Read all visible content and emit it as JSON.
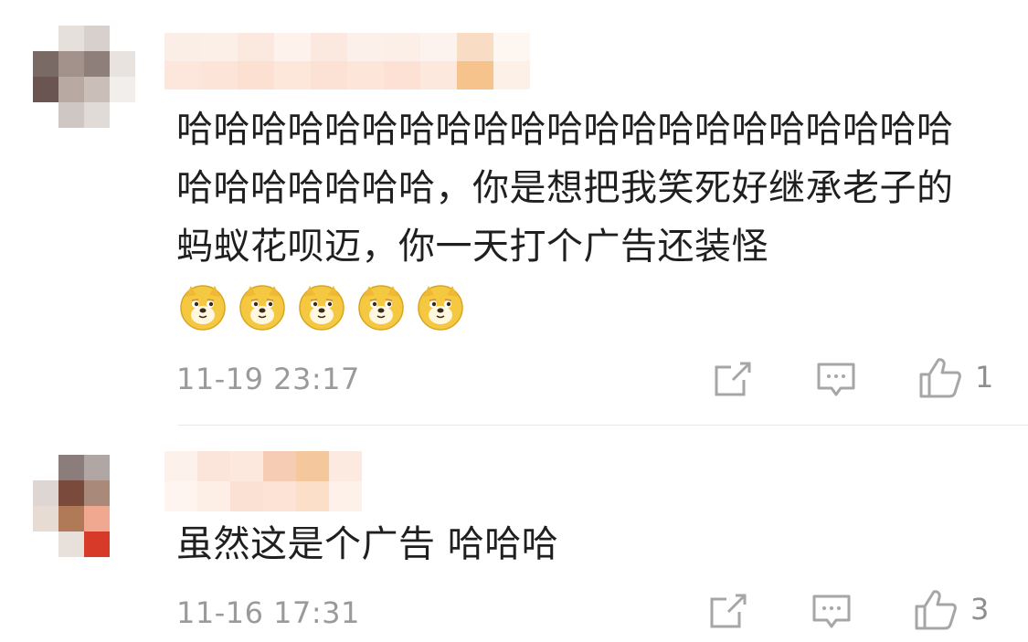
{
  "comments": [
    {
      "text": "哈哈哈哈哈哈哈哈哈哈哈哈哈哈哈哈哈哈哈哈哈哈哈哈哈哈哈哈，你是想把我笑死好继承老子的蚂蚁花呗迈，你一天打个广告还装怪",
      "emoji_name": "doge-emoji",
      "emoji_count": 5,
      "timestamp": "11-19 23:17",
      "likes": "1"
    },
    {
      "text": "虽然这是个广告 哈哈哈",
      "timestamp": "11-16 17:31",
      "likes": "3"
    }
  ],
  "icons": {
    "share": "share-icon",
    "comment": "comment-icon",
    "like": "thumbs-up-icon"
  },
  "colors": {
    "meta_text": "#9a9a9a",
    "icon": "#a6a6a6",
    "doge_face": "#f5c842"
  }
}
